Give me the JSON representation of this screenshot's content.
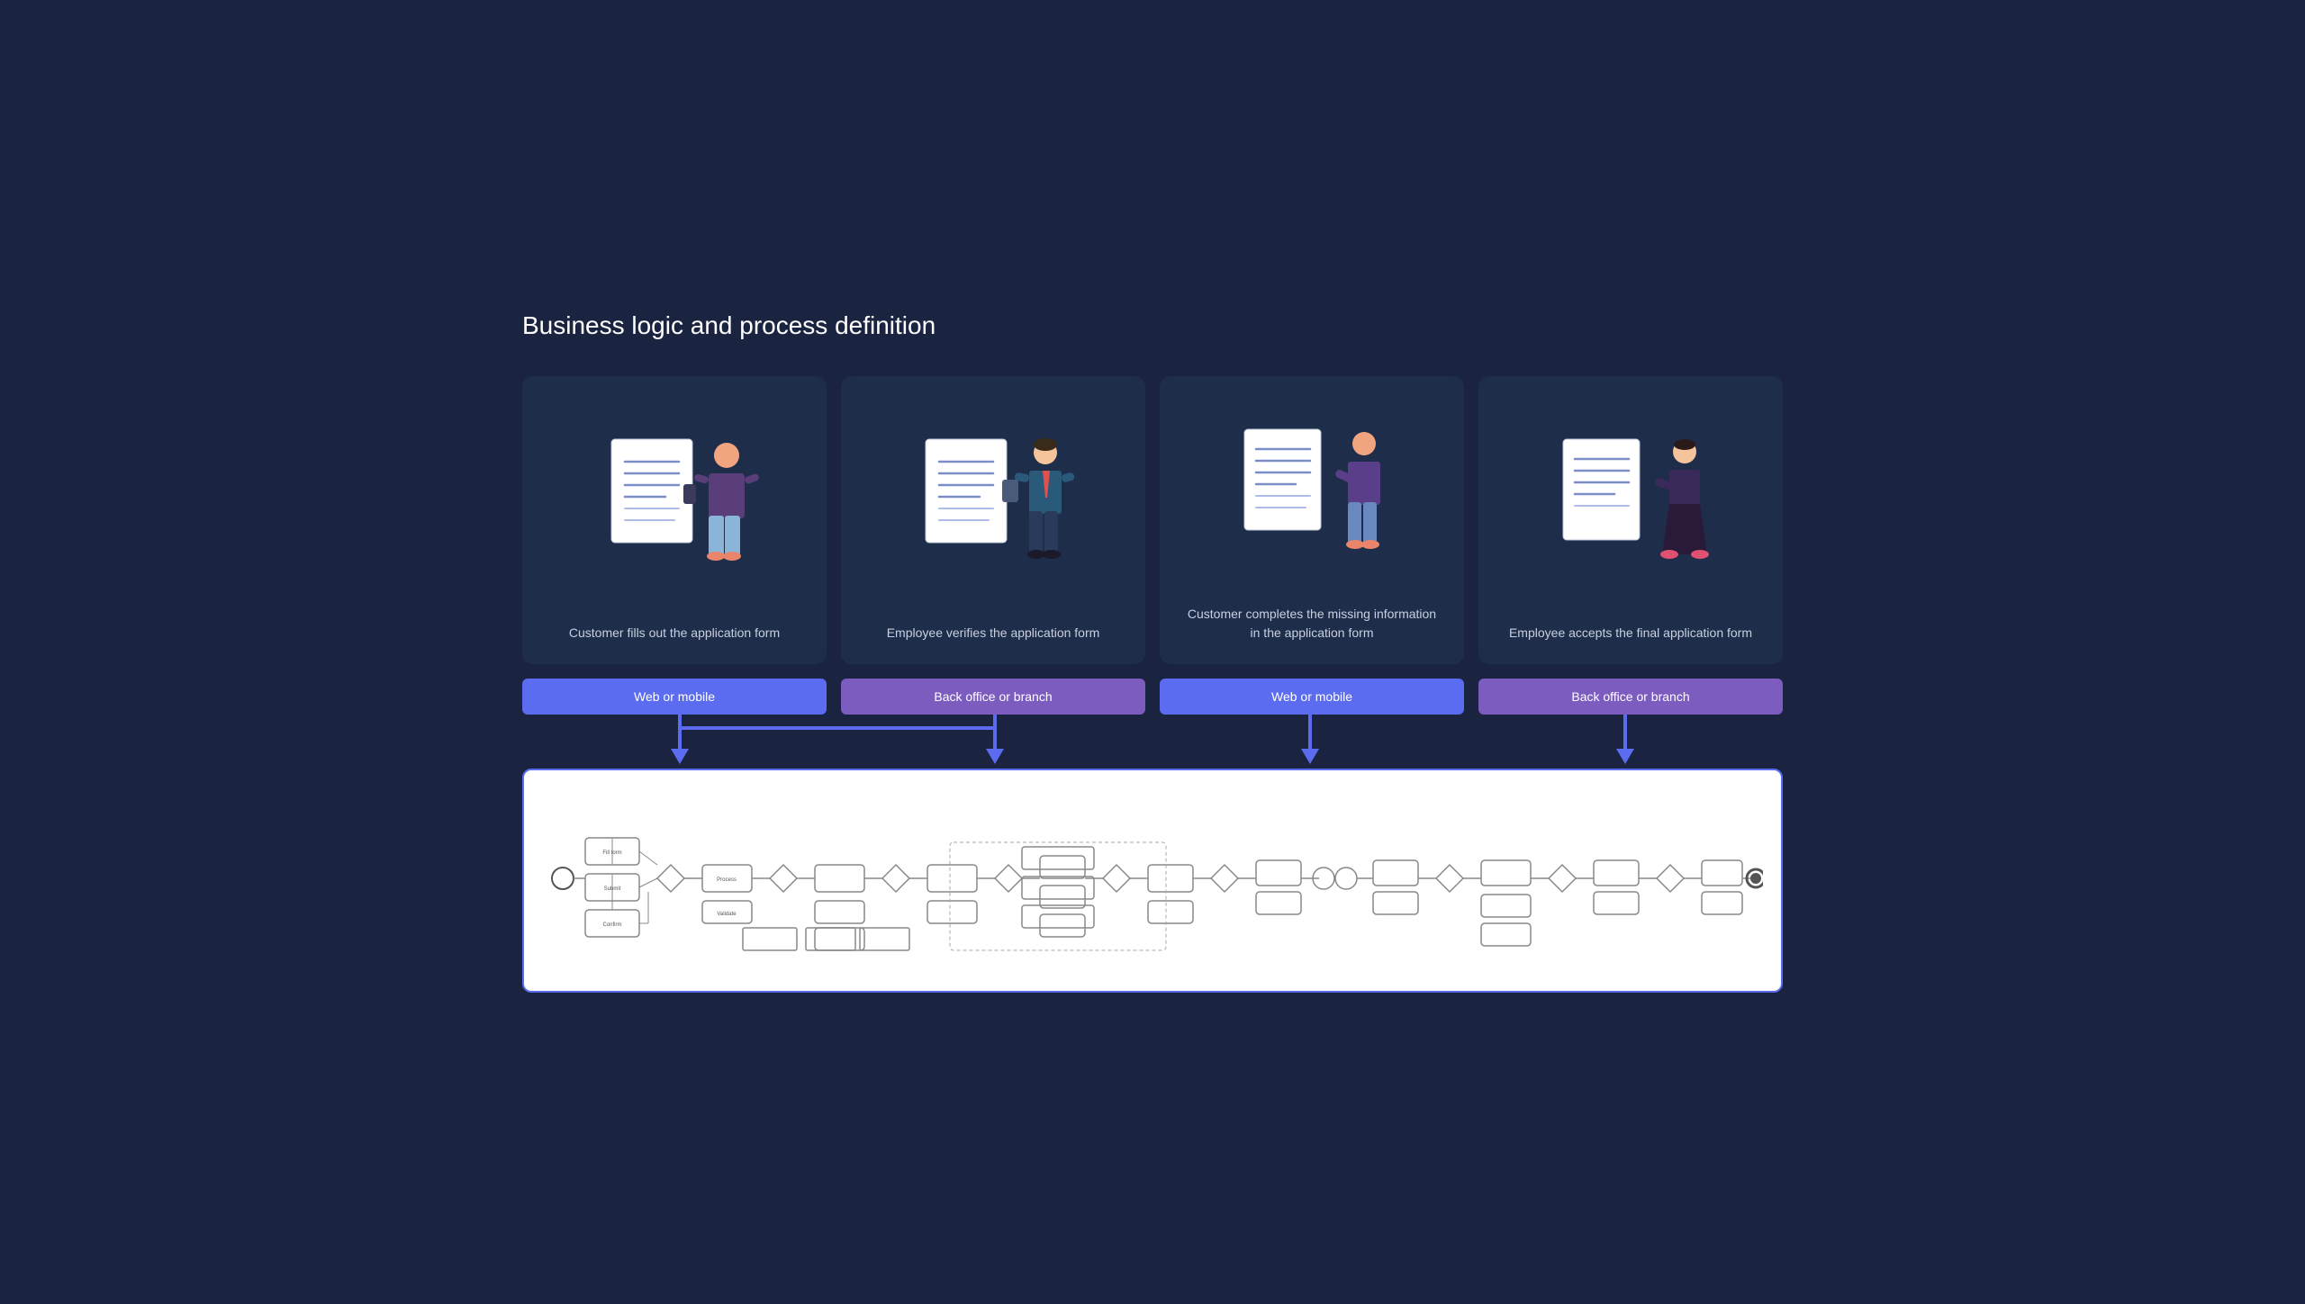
{
  "page": {
    "title": "Business logic and process definition",
    "backgroundColor": "#1a2340"
  },
  "cards": [
    {
      "id": "card-1",
      "label": "Customer fills out the application form",
      "channel": "Web or mobile",
      "channelType": "web-mobile",
      "figureType": "customer-doc"
    },
    {
      "id": "card-2",
      "label": "Employee verifies the application form",
      "channel": "Back office or branch",
      "channelType": "back-office",
      "figureType": "employee-doc"
    },
    {
      "id": "card-3",
      "label": "Customer completes the missing information in the application form",
      "channel": "Web or mobile",
      "channelType": "web-mobile",
      "figureType": "customer-doc-2"
    },
    {
      "id": "card-4",
      "label": "Employee accepts the final application form",
      "channel": "Back office or branch",
      "channelType": "back-office",
      "figureType": "employee-doc-2"
    }
  ],
  "diagram": {
    "borderColor": "#5b6cf0",
    "arrowColor": "#5b6cf0",
    "bgColor": "#ffffff"
  }
}
